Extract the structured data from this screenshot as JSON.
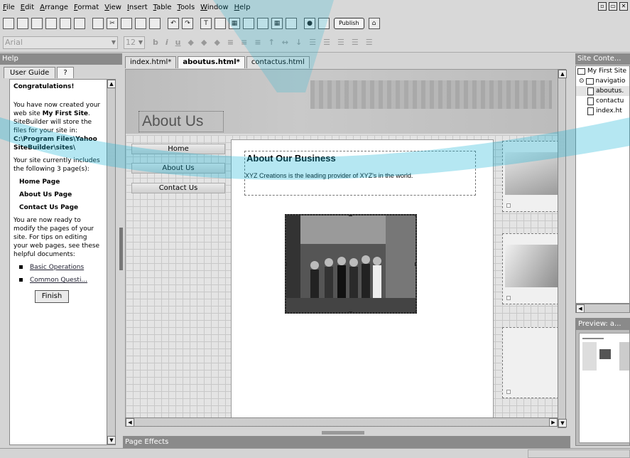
{
  "menu": [
    "File",
    "Edit",
    "Arrange",
    "Format",
    "View",
    "Insert",
    "Table",
    "Tools",
    "Window",
    "Help"
  ],
  "toolbar": {
    "publish_label": "Publish"
  },
  "format": {
    "font": "Arial",
    "size": "12",
    "bold": "b",
    "italic": "i",
    "underline": "u"
  },
  "help_panel": {
    "title": "Help",
    "tabs": [
      "User Guide",
      "?"
    ],
    "heading": "Congratulations!",
    "p1_a": "You have now created your web site ",
    "p1_site": "My First Site",
    "p1_b": ". SiteBuilder will store the files for your site in: ",
    "p1_path": "C:\\Program Files\\Yahoo SiteBuilder\\sites\\",
    "p2": "Your site currently includes the following 3 page(s):",
    "pages": [
      "Home Page",
      "About Us Page",
      "Contact Us Page"
    ],
    "p3": "You are now ready to modify the pages of your site. For tips on editing your web pages, see these helpful documents:",
    "links": [
      "Basic Operations",
      "Common Questi..."
    ],
    "finish_label": "Finish"
  },
  "doc_tabs": [
    "index.html*",
    "aboutus.html*",
    "contactus.html"
  ],
  "page": {
    "title": "About Us",
    "nav": [
      "Home",
      "About Us",
      "Contact Us"
    ],
    "biz_title": "About Our Business",
    "biz_text": "XYZ Creations is the leading provider of XYZ's in the world."
  },
  "page_effects_label": "Page Effects",
  "site_panel": {
    "title": "Site Conte...",
    "tree": [
      "My First Site",
      "navigatio",
      "aboutus.",
      "contactu",
      "index.ht"
    ]
  },
  "preview_title": "Preview: a..."
}
